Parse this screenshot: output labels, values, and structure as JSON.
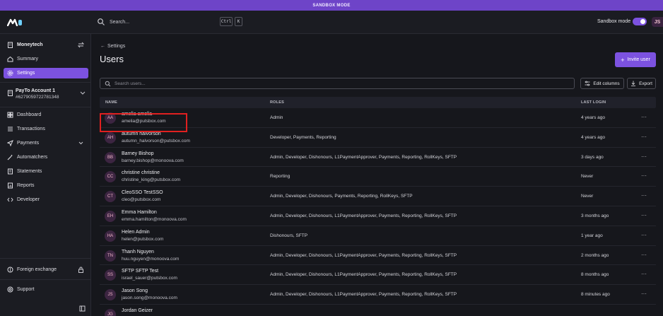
{
  "banner": {
    "text": "SANDBOX MODE"
  },
  "topbar": {
    "search_placeholder": "Search...",
    "shortcut_ctrl": "Ctrl",
    "shortcut_key": "K",
    "sandbox_label": "Sandbox mode",
    "user_initials": "JS"
  },
  "sidebar": {
    "org_name": "Moneytech",
    "summary": "Summary",
    "settings": "Settings",
    "account_name": "PayTo Account 1",
    "account_number": "#6279059722781348",
    "dashboard": "Dashboard",
    "transactions": "Transactions",
    "payments": "Payments",
    "automatchers": "Automatchers",
    "statements": "Statements",
    "reports": "Reports",
    "developer": "Developer",
    "foreign_exchange": "Foreign exchange",
    "support": "Support"
  },
  "main": {
    "back_label": "Settings",
    "title": "Users",
    "invite_label": "Invite user",
    "search_placeholder": "Search users...",
    "edit_columns_label": "Edit columns",
    "export_label": "Export",
    "columns": {
      "name": "NAME",
      "roles": "ROLES",
      "last_login": "LAST LOGIN"
    },
    "users": [
      {
        "initials": "AA",
        "name": "amelia amelia",
        "email": "amelia@putsbox.com",
        "roles": "Admin",
        "last_login": "4 years ago"
      },
      {
        "initials": "AH",
        "name": "autumn halvorson",
        "email": "autumn_halvorson@putsbox.com",
        "roles": "Developer, Payments, Reporting",
        "last_login": "4 years ago"
      },
      {
        "initials": "BB",
        "name": "Barney Bishop",
        "email": "barney.bishop@monoova.com",
        "roles": "Admin, Developer, Dishonours, L1PaymentApprover, Payments, Reporting, RollKeys, SFTP",
        "last_login": "3 days ago"
      },
      {
        "initials": "CC",
        "name": "christine christine",
        "email": "christine_king@putsbox.com",
        "roles": "Reporting",
        "last_login": "Never"
      },
      {
        "initials": "CT",
        "name": "CleoSSO TestSSO",
        "email": "cleo@putsbox.com",
        "roles": "Admin, Developer, Dishonours, Payments, Reporting, RollKeys, SFTP",
        "last_login": "Never"
      },
      {
        "initials": "EH",
        "name": "Emma Hamilton",
        "email": "emma.hamilton@monoova.com",
        "roles": "Admin, Developer, Dishonours, L1PaymentApprover, Payments, Reporting, RollKeys, SFTP",
        "last_login": "3 months ago"
      },
      {
        "initials": "HA",
        "name": "Helen Admin",
        "email": "helen@putsbox.com",
        "roles": "Dishonours, SFTP",
        "last_login": "1 year ago"
      },
      {
        "initials": "TN",
        "name": "Thanh Nguyen",
        "email": "huu.nguyen@monoova.com",
        "roles": "Admin, Developer, Dishonours, L1PaymentApprover, Payments, Reporting, RollKeys, SFTP",
        "last_login": "2 months ago"
      },
      {
        "initials": "SS",
        "name": "SFTP SFTP Test",
        "email": "israel_sauer@putsbox.com",
        "roles": "Admin, Developer, Dishonours, L1PaymentApprover, Payments, Reporting, RollKeys, SFTP",
        "last_login": "8 months ago"
      },
      {
        "initials": "JS",
        "name": "Jason Song",
        "email": "jason.song@monoova.com",
        "roles": "Admin, Developer, Dishonours, L1PaymentApprover, Payments, Reporting, RollKeys, SFTP",
        "last_login": "8 minutes ago"
      },
      {
        "initials": "JG",
        "name": "Jordan Geizer",
        "email": "",
        "roles": "",
        "last_login": ""
      }
    ],
    "more_glyph": "···"
  },
  "colors": {
    "accent": "#7c52e0",
    "banner": "#6e44c8",
    "highlight": "#e02020",
    "background": "#16171c"
  }
}
